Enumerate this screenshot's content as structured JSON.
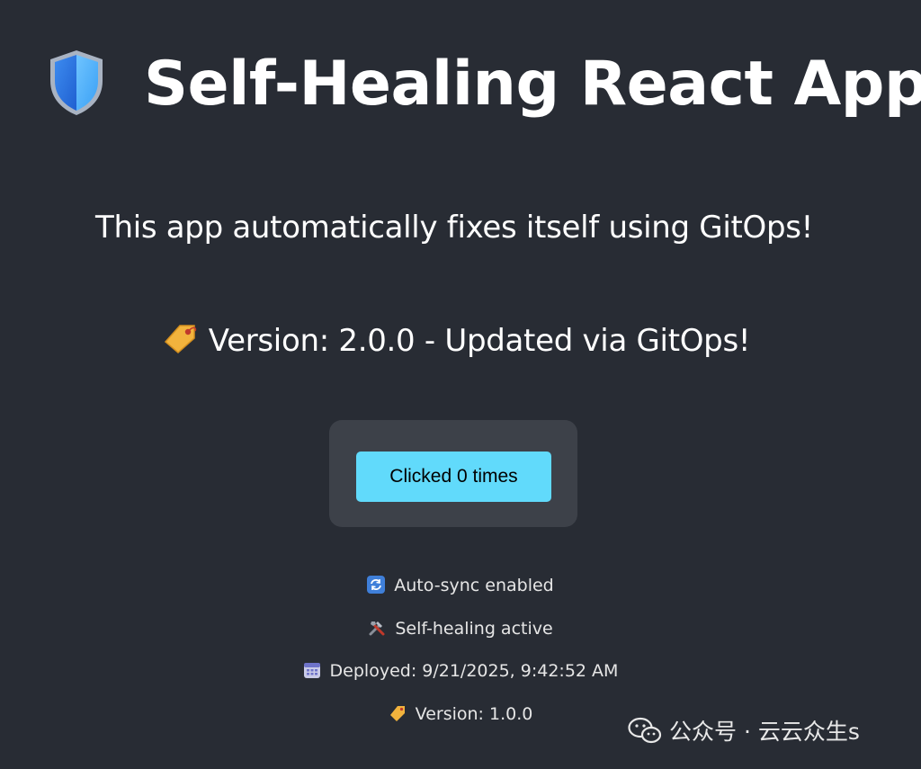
{
  "header": {
    "title": "Self-Healing React App",
    "logo_icon": "shield-icon"
  },
  "subtitle": "This app automatically fixes itself using GitOps!",
  "version_banner": {
    "icon": "tag-icon",
    "text": "Version: 2.0.0 - Updated via GitOps!"
  },
  "counter": {
    "button_label": "Clicked 0 times"
  },
  "status": {
    "autosync": {
      "icon": "sync-icon",
      "text": "Auto-sync enabled"
    },
    "selfheal": {
      "icon": "tools-icon",
      "text": "Self-healing active"
    },
    "deployed": {
      "icon": "calendar-icon",
      "text": "Deployed: 9/21/2025, 9:42:52 AM"
    },
    "version": {
      "icon": "tag-icon",
      "text": "Version: 1.0.0"
    }
  },
  "watermark": {
    "icon": "wechat-icon",
    "text": "公众号 · 云云众生s"
  },
  "colors": {
    "background": "#282c34",
    "card": "#3d4149",
    "accent": "#61dafb",
    "text": "#ffffff"
  }
}
